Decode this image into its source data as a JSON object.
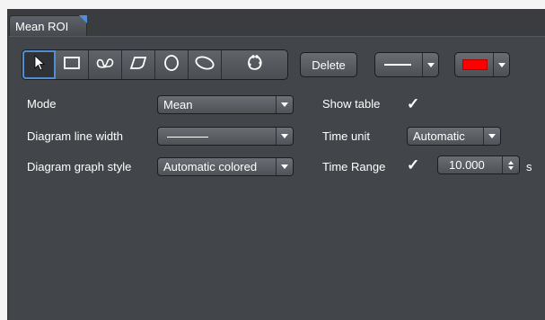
{
  "panel": {
    "tab_title": "Mean ROI"
  },
  "toolbar": {
    "tools": [
      {
        "name": "pointer-tool",
        "icon": "arrow-cursor-icon"
      },
      {
        "name": "rectangle-tool",
        "icon": "rectangle-icon"
      },
      {
        "name": "closed-bezier-tool",
        "icon": "bezier-icon"
      },
      {
        "name": "polygon-tool",
        "icon": "polygon-icon"
      },
      {
        "name": "circle-tool",
        "icon": "circle-icon"
      },
      {
        "name": "ellipse-tool",
        "icon": "ellipse-icon"
      },
      {
        "name": "closed-freehand-tool",
        "icon": "freehand-icon"
      }
    ],
    "delete_label": "Delete",
    "line_style_icon": "line-style-icon",
    "color_swatch": "#ff0000"
  },
  "left_form": {
    "mode_label": "Mode",
    "mode_value": "Mean",
    "line_width_label": "Diagram line width",
    "graph_style_label": "Diagram graph style",
    "graph_style_value": "Automatic colored"
  },
  "right_form": {
    "show_table_label": "Show table",
    "show_table_checked": true,
    "time_unit_label": "Time unit",
    "time_unit_value": "Automatic",
    "time_range_label": "Time Range",
    "time_range_checked": true,
    "time_range_value": "10.000",
    "time_range_unit": "s"
  },
  "colors": {
    "background": "#424549",
    "accent": "#4f8fd4",
    "swatch": "#ff0000"
  }
}
